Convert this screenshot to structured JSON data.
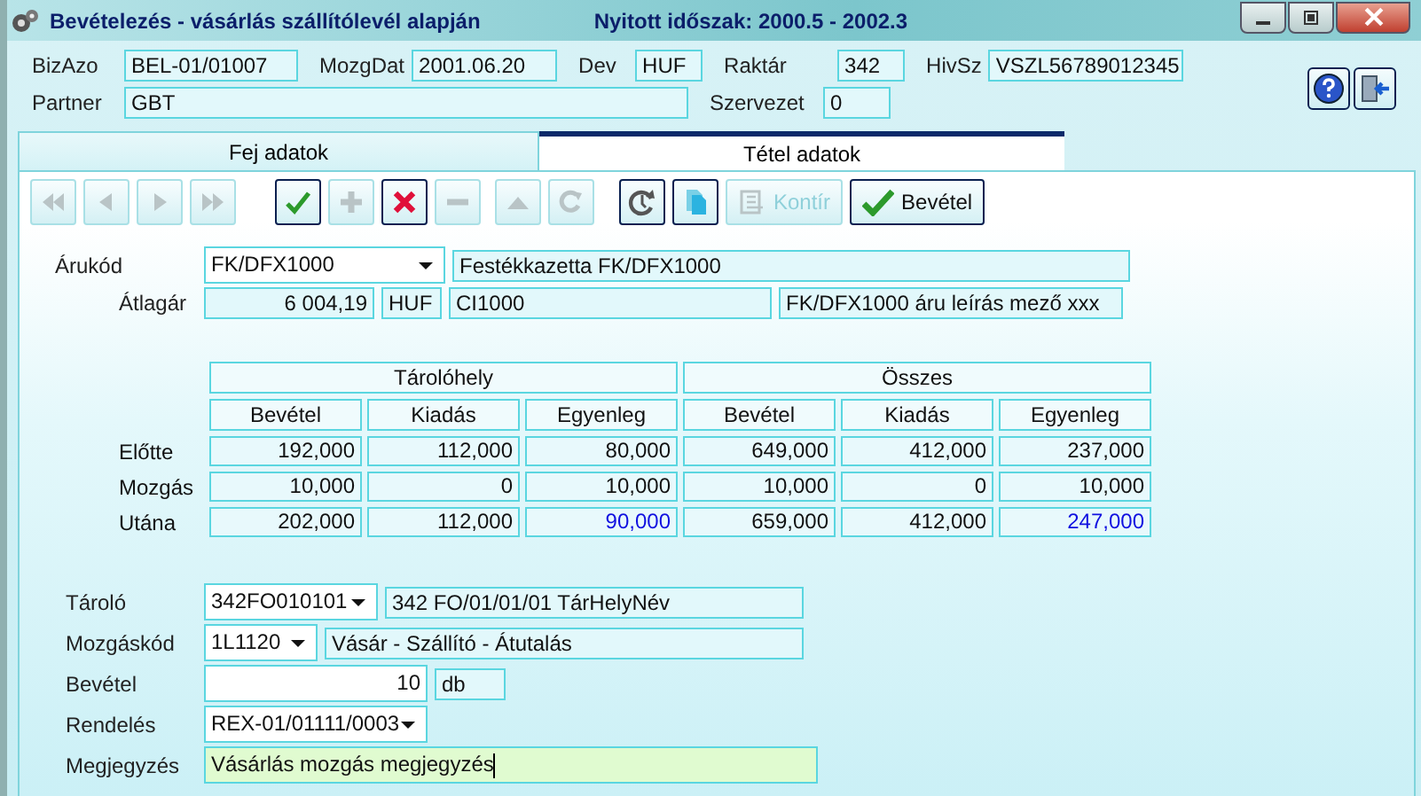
{
  "window": {
    "title": "Bevételezés - vásárlás szállítólevél alapján",
    "period": "Nyitott időszak: 2000.5 - 2002.3"
  },
  "header": {
    "row1": [
      {
        "label": "BizAzo",
        "value": "BEL-01/01007"
      },
      {
        "label": "MozgDat",
        "value": "2001.06.20"
      },
      {
        "label": "Dev",
        "value": "HUF"
      },
      {
        "label": "Raktár",
        "value": "342"
      },
      {
        "label": "HivSz",
        "value": "VSZL56789012345"
      }
    ],
    "row2": [
      {
        "label": "Partner",
        "value": "GBT"
      },
      {
        "label": "Szervezet",
        "value": "0"
      }
    ]
  },
  "tabs": [
    {
      "label": "Fej adatok",
      "selected": false
    },
    {
      "label": "Tétel adatok",
      "selected": true
    }
  ],
  "toolbar": [
    {
      "kind": "first",
      "disabled": true
    },
    {
      "kind": "prev",
      "disabled": true
    },
    {
      "kind": "next",
      "disabled": true
    },
    {
      "kind": "last",
      "disabled": true
    },
    {
      "kind": "confirm",
      "disabled": false
    },
    {
      "kind": "add",
      "disabled": true
    },
    {
      "kind": "delete",
      "disabled": false
    },
    {
      "kind": "remove",
      "disabled": true
    },
    {
      "kind": "up",
      "disabled": true
    },
    {
      "kind": "redo",
      "disabled": true
    },
    {
      "kind": "refresh",
      "disabled": false
    },
    {
      "kind": "copy",
      "disabled": false
    },
    {
      "kind": "account",
      "label": "Kontír",
      "disabled": true
    },
    {
      "kind": "receive",
      "label": "Bevétel",
      "disabled": false
    }
  ],
  "item": {
    "code_label": "Árukód",
    "code": "FK/DFX1000",
    "name": "Festékkazetta FK/DFX1000",
    "price_label": "Átlagár",
    "price": "6 004,19",
    "currency": "HUF",
    "short_code": "CI1000",
    "description": "FK/DFX1000 áru leírás mező xxx"
  },
  "stock": {
    "groups": [
      "Tárolóhely",
      "Összes"
    ],
    "columns": [
      "Bevétel",
      "Kiadás",
      "Egyenleg",
      "Bevétel",
      "Kiadás",
      "Egyenleg"
    ],
    "rows": [
      {
        "label": "Előtte",
        "cells": [
          {
            "text": "192,000",
            "highlighted": false
          },
          {
            "text": "112,000",
            "highlighted": false
          },
          {
            "text": "80,000",
            "highlighted": false
          },
          {
            "text": "649,000",
            "highlighted": false
          },
          {
            "text": "412,000",
            "highlighted": false
          },
          {
            "text": "237,000",
            "highlighted": false
          }
        ]
      },
      {
        "label": "Mozgás",
        "cells": [
          {
            "text": "10,000",
            "highlighted": false
          },
          {
            "text": "0",
            "highlighted": false
          },
          {
            "text": "10,000",
            "highlighted": false
          },
          {
            "text": "10,000",
            "highlighted": false
          },
          {
            "text": "0",
            "highlighted": false
          },
          {
            "text": "10,000",
            "highlighted": false
          }
        ]
      },
      {
        "label": "Utána",
        "cells": [
          {
            "text": "202,000",
            "highlighted": false
          },
          {
            "text": "112,000",
            "highlighted": false
          },
          {
            "text": "90,000",
            "highlighted": true
          },
          {
            "text": "659,000",
            "highlighted": false
          },
          {
            "text": "412,000",
            "highlighted": false
          },
          {
            "text": "247,000",
            "highlighted": true
          }
        ]
      }
    ]
  },
  "movement": {
    "storage_label": "Tároló",
    "storage_code": "342FO010101",
    "storage_name": "342 FO/01/01/01  TárHelyNév",
    "code_label": "Mozgáskód",
    "movement_code": "1L1120",
    "movement_name": "Vásár - Szállító - Átutalás",
    "qty_label": "Bevétel",
    "quantity": "10",
    "unit": "db",
    "order_label": "Rendelés",
    "order": "REX-01/01111/0003",
    "note_label": "Megjegyzés",
    "note": "Vásárlás mozgás megjegyzés",
    "note_focused": true
  }
}
